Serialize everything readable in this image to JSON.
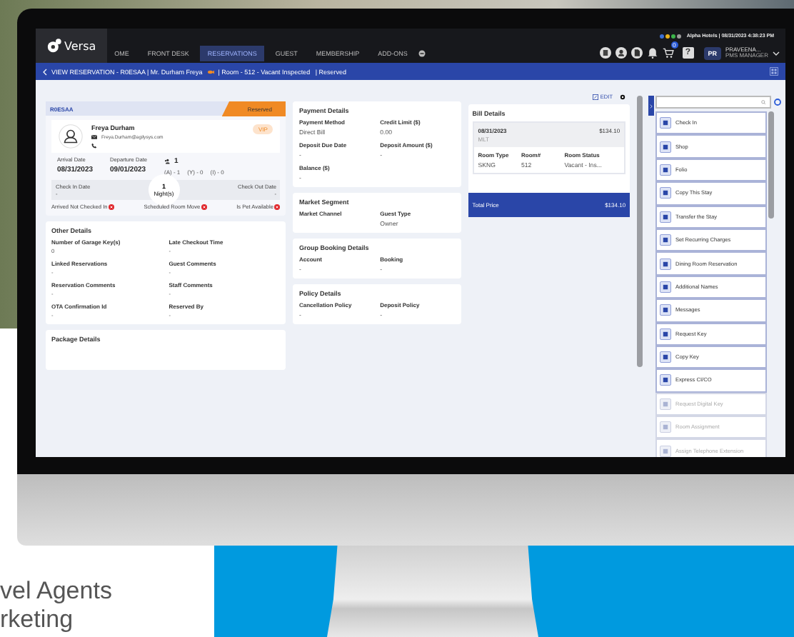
{
  "top_info": {
    "hotel": "Alpha Hotels | 08/31/2023 4:38:23 PM",
    "status_dots": [
      {
        "color": "#3b6fd6"
      },
      {
        "color": "#e8b21c"
      },
      {
        "color": "#3cb44a"
      },
      {
        "color": "#9a9a9a"
      }
    ]
  },
  "app": {
    "logo": "Versa"
  },
  "nav": [
    {
      "label": "OME",
      "selected": false
    },
    {
      "label": "FRONT DESK",
      "selected": false
    },
    {
      "label": "RESERVATIONS",
      "selected": true
    },
    {
      "label": "GUEST",
      "selected": false
    },
    {
      "label": "MEMBERSHIP",
      "selected": false
    },
    {
      "label": "ADD-ONS",
      "selected": false
    }
  ],
  "cart_count": "0",
  "help_label": "?",
  "user": {
    "initials": "PR",
    "name": "PRAVEENA...",
    "role": "PMS MANAGER"
  },
  "breadcrumb": "VIEW RESERVATION - R0ESAA | Mr. Durham Freya",
  "breadcrumb_rest": "| Room - 512 - Vacant Inspected   | Reserved",
  "reservation": {
    "code": "R0ESAA",
    "status": "Reserved",
    "guest_name": "Freya Durham",
    "email": "Freya.Durham@agilysys.com",
    "vip": "VIP",
    "arrival_label": "Arrival Date",
    "arrival": "08/31/2023",
    "departure_label": "Departure Date",
    "departure": "09/01/2023",
    "guests": "1",
    "guest_breakdown": [
      "(A) - 1",
      "(Y) - 0",
      "(I) - 0"
    ],
    "check_in_label": "Check In Date",
    "check_in": "-",
    "nights": "1",
    "nights_label": "Night(s)",
    "check_out_label": "Check Out Date",
    "check_out": "-",
    "flags": [
      {
        "label": "Arrived Not Checked In",
        "on": false
      },
      {
        "label": "Scheduled Room Move",
        "on": false
      },
      {
        "label": "Is Pet Available",
        "on": false
      }
    ]
  },
  "other_details": {
    "title": "Other Details",
    "fields": [
      {
        "label": "Number of Garage Key(s)",
        "value": "0"
      },
      {
        "label": "Late Checkout Time",
        "value": "-"
      },
      {
        "label": "Linked Reservations",
        "value": "-"
      },
      {
        "label": "Guest Comments",
        "value": "-"
      },
      {
        "label": "Reservation Comments",
        "value": "-"
      },
      {
        "label": "Staff Comments",
        "value": "-"
      },
      {
        "label": "OTA Confirmation Id",
        "value": "-"
      },
      {
        "label": "Reserved By",
        "value": "-"
      }
    ]
  },
  "package_details": {
    "title": "Package Details"
  },
  "middle_cards": [
    {
      "title": "Payment Details",
      "fields": [
        {
          "label": "Payment Method",
          "value": "Direct Bill"
        },
        {
          "label": "Credit Limit ($)",
          "value": "0.00"
        },
        {
          "label": "Deposit Due Date",
          "value": "-"
        },
        {
          "label": "Deposit Amount ($)",
          "value": "-"
        },
        {
          "label": "Balance ($)",
          "value": "-"
        }
      ]
    },
    {
      "title": "Market Segment",
      "fields": [
        {
          "label": "Market Channel"
        },
        {
          "label": "Guest Type",
          "value": "Owner"
        }
      ]
    },
    {
      "title": "Group Booking Details",
      "fields": [
        {
          "label": "Account",
          "value": "-"
        },
        {
          "label": "Booking",
          "value": "-"
        }
      ]
    },
    {
      "title": "Policy Details",
      "fields": [
        {
          "label": "Cancellation Policy",
          "value": "-"
        },
        {
          "label": "Deposit Policy",
          "value": "-"
        }
      ]
    }
  ],
  "edit_label": "EDIT",
  "bill": {
    "title": "Bill Details",
    "date": "08/31/2023",
    "rate_code": "MLT",
    "amount": "$134.10",
    "columns": [
      {
        "label": "Room Type",
        "value": "SKNG"
      },
      {
        "label": "Room#",
        "value": "512"
      },
      {
        "label": "Room Status",
        "value": "Vacant - Ins..."
      }
    ],
    "total_label": "Total Price",
    "total": "$134.10"
  },
  "actions": [
    {
      "label": "Check In",
      "disabled": false
    },
    {
      "label": "Shop",
      "disabled": false
    },
    {
      "label": "Folio",
      "disabled": false
    },
    {
      "label": "Copy This Stay",
      "disabled": false
    },
    {
      "label": "Transfer the Stay",
      "disabled": false
    },
    {
      "label": "Set Recurring Charges",
      "disabled": false
    },
    {
      "label": "Dining Room Reservation",
      "disabled": false
    },
    {
      "label": "Additional Names",
      "disabled": false
    },
    {
      "label": "Messages",
      "disabled": false
    },
    {
      "label": "Request Key",
      "disabled": false
    },
    {
      "label": "Copy Key",
      "disabled": false
    },
    {
      "label": "Express CI/CO",
      "disabled": false
    },
    {
      "label": "Request Digital Key",
      "disabled": true
    },
    {
      "label": "Room Assignment",
      "disabled": true
    },
    {
      "label": "Assign Telephone Extension",
      "disabled": true
    }
  ],
  "page_text": [
    "vel Agents",
    "rketing"
  ]
}
